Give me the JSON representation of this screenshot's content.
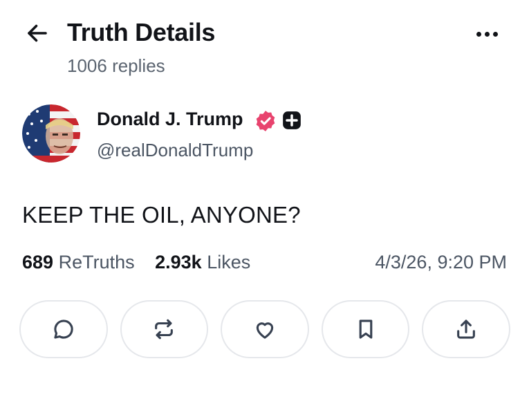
{
  "header": {
    "title": "Truth Details",
    "subtitle": "1006 replies",
    "back_icon": "arrow-left-icon",
    "more_icon": "more-horizontal-icon"
  },
  "author": {
    "name": "Donald J. Trump",
    "handle": "@realDonaldTrump",
    "verified_color": "#e8436e",
    "badge_icon": "plus-badge-icon"
  },
  "post": {
    "text": "KEEP THE OIL, ANYONE?"
  },
  "stats": {
    "retruths_count": "689",
    "retruths_label": "ReTruths",
    "likes_count": "2.93k",
    "likes_label": "Likes",
    "timestamp": "4/3/26, 9:20 PM"
  },
  "actions": [
    {
      "icon": "reply-icon"
    },
    {
      "icon": "retruth-icon"
    },
    {
      "icon": "like-icon"
    },
    {
      "icon": "bookmark-icon"
    },
    {
      "icon": "share-icon"
    }
  ],
  "colors": {
    "text_primary": "#111318",
    "text_secondary": "#4b5563",
    "border": "#e5e7eb"
  }
}
